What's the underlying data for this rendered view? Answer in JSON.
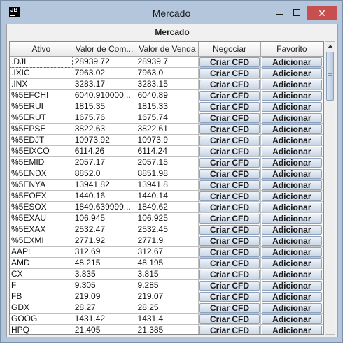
{
  "window": {
    "title": "Mercado",
    "app_icon_text": "JB",
    "close_glyph": "✕"
  },
  "panel": {
    "title": "Mercado"
  },
  "columns": [
    "Ativo",
    "Valor de Com...",
    "Valor de Venda",
    "Negociar",
    "Favorito"
  ],
  "rows": [
    [
      ".DJI",
      "28939.72",
      "28939.7",
      "Criar CFD",
      "Adicionar"
    ],
    [
      ".IXIC",
      "7963.02",
      "7963.0",
      "Criar CFD",
      "Adicionar"
    ],
    [
      ".INX",
      "3283.17",
      "3283.15",
      "Criar CFD",
      "Adicionar"
    ],
    [
      "%5EFCHI",
      "6040.910000...",
      "6040.89",
      "Criar CFD",
      "Adicionar"
    ],
    [
      "%5ERUI",
      "1815.35",
      "1815.33",
      "Criar CFD",
      "Adicionar"
    ],
    [
      "%5ERUT",
      "1675.76",
      "1675.74",
      "Criar CFD",
      "Adicionar"
    ],
    [
      "%5EPSE",
      "3822.63",
      "3822.61",
      "Criar CFD",
      "Adicionar"
    ],
    [
      "%5EDJT",
      "10973.92",
      "10973.9",
      "Criar CFD",
      "Adicionar"
    ],
    [
      "%5EIXCO",
      "6114.26",
      "6114.24",
      "Criar CFD",
      "Adicionar"
    ],
    [
      "%5EMID",
      "2057.17",
      "2057.15",
      "Criar CFD",
      "Adicionar"
    ],
    [
      "%5ENDX",
      "8852.0",
      "8851.98",
      "Criar CFD",
      "Adicionar"
    ],
    [
      "%5ENYA",
      "13941.82",
      "13941.8",
      "Criar CFD",
      "Adicionar"
    ],
    [
      "%5EOEX",
      "1440.16",
      "1440.14",
      "Criar CFD",
      "Adicionar"
    ],
    [
      "%5ESOX",
      "1849.639999...",
      "1849.62",
      "Criar CFD",
      "Adicionar"
    ],
    [
      "%5EXAU",
      "106.945",
      "106.925",
      "Criar CFD",
      "Adicionar"
    ],
    [
      "%5EXAX",
      "2532.47",
      "2532.45",
      "Criar CFD",
      "Adicionar"
    ],
    [
      "%5EXMI",
      "2771.92",
      "2771.9",
      "Criar CFD",
      "Adicionar"
    ],
    [
      "AAPL",
      "312.69",
      "312.67",
      "Criar CFD",
      "Adicionar"
    ],
    [
      "AMD",
      "48.215",
      "48.195",
      "Criar CFD",
      "Adicionar"
    ],
    [
      "CX",
      "3.835",
      "3.815",
      "Criar CFD",
      "Adicionar"
    ],
    [
      "F",
      "9.305",
      "9.285",
      "Criar CFD",
      "Adicionar"
    ],
    [
      "FB",
      "219.09",
      "219.07",
      "Criar CFD",
      "Adicionar"
    ],
    [
      "GDX",
      "28.27",
      "28.25",
      "Criar CFD",
      "Adicionar"
    ],
    [
      "GOOG",
      "1431.42",
      "1431.4",
      "Criar CFD",
      "Adicionar"
    ],
    [
      "HPQ",
      "21.405",
      "21.385",
      "Criar CFD",
      "Adicionar"
    ]
  ]
}
